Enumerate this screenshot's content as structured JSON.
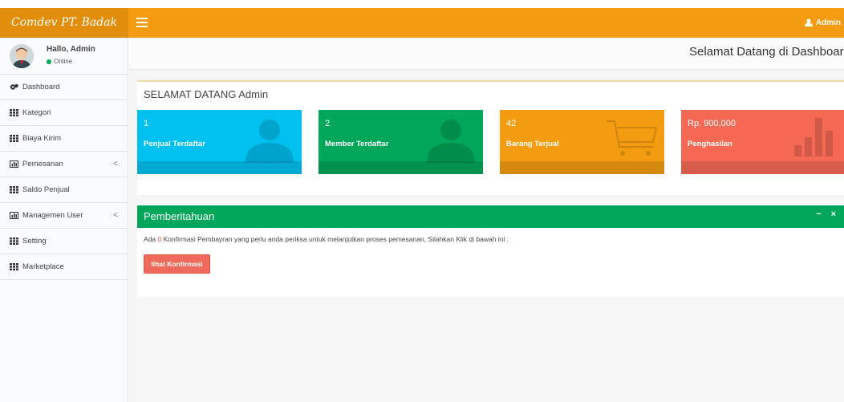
{
  "navbar": {
    "brand": "Comdev PT. Badak",
    "user_label": "Admin"
  },
  "sidebar": {
    "user": {
      "greeting": "Hallo, Admin",
      "status": "Online"
    },
    "items": [
      {
        "label": "Dashboard",
        "icon": "dashboard-icon"
      },
      {
        "label": "Kategori",
        "icon": "grid-icon"
      },
      {
        "label": "Biaya Kirim",
        "icon": "grid-icon"
      },
      {
        "label": "Pemesanan",
        "icon": "bar-chart-icon",
        "has_submenu": true
      },
      {
        "label": "Saldo Penjual",
        "icon": "grid-icon"
      },
      {
        "label": "Managemen User",
        "icon": "bar-chart-icon",
        "has_submenu": true
      },
      {
        "label": "Setting",
        "icon": "grid-icon"
      },
      {
        "label": "Marketplace",
        "icon": "grid-icon"
      }
    ],
    "chevron": "<"
  },
  "header": {
    "title": "Selamat Datang di Dashboard"
  },
  "welcome": {
    "title": "SELAMAT DATANG Admin",
    "stats": [
      {
        "value": "1",
        "label": "Penjual Terdaftar",
        "color": "#00c0ef",
        "icon": "user-icon"
      },
      {
        "value": "2",
        "label": "Member Terdaftar",
        "color": "#00a65a",
        "icon": "user-icon"
      },
      {
        "value": "42",
        "label": "Barang Terjual",
        "color": "#f39c12",
        "icon": "cart-icon"
      },
      {
        "value": "Rp. 900,000",
        "label": "Penghasilan",
        "color": "#f56954",
        "icon": "bar-chart-icon"
      }
    ]
  },
  "notification": {
    "title": "Pemberitahuan",
    "text_before": "Ada ",
    "count": "0",
    "text_after": " Konfirmasi Pembayran yang perlu anda periksa untuk melanjutkan proses pemesanan, Silahkan Klik di bawah ini :",
    "button_label": "lihat Konfirmasi",
    "collapse_symbol": "−",
    "close_symbol": "×"
  },
  "colors": {
    "navbar": "#f39c12",
    "logo_bg": "#e08e0b",
    "notif_header": "#00a65a",
    "button": "#f06a5b"
  }
}
